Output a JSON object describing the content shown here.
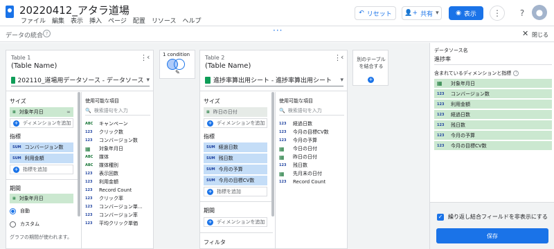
{
  "app": {
    "title": "20220412_アタラ道場",
    "menu": [
      "ファイル",
      "編集",
      "表示",
      "挿入",
      "ページ",
      "配置",
      "リソース",
      "ヘルプ"
    ]
  },
  "toolbar": {
    "reset": "リセット",
    "share": "共有",
    "view": "表示"
  },
  "subbar": {
    "title": "データの統合",
    "close": "閉じる"
  },
  "join": {
    "label": "1 condition"
  },
  "table1": {
    "name": "Table 1",
    "alias": "(Table Name)",
    "source": "202110_道場用データソース - データソース",
    "dims_label": "サイズ",
    "dims": [
      "対象年月日"
    ],
    "add_dim": "ディメンションを追加",
    "metrics_label": "指標",
    "metrics": [
      "コンバージョン数",
      "利用金額"
    ],
    "add_metric": "指標を追加",
    "period_label": "期間",
    "period_field": "対象年月日",
    "period_auto": "自動",
    "period_custom": "カスタム",
    "period_note": "グラフの期間が使われます。",
    "avail_label": "使用可能な項目",
    "search": "検索語句を入力",
    "fields": [
      {
        "t": "ABC",
        "n": "キャンペーン"
      },
      {
        "t": "123",
        "n": "クリック数"
      },
      {
        "t": "123",
        "n": "コンバージョン数"
      },
      {
        "t": "cal",
        "n": "対象年月日"
      },
      {
        "t": "ABC",
        "n": "媒体"
      },
      {
        "t": "ABC",
        "n": "媒体種別"
      },
      {
        "t": "123",
        "n": "表示回数"
      },
      {
        "t": "123",
        "n": "利用金額"
      },
      {
        "t": "123",
        "n": "Record Count"
      },
      {
        "t": "123",
        "n": "クリック率"
      },
      {
        "t": "123",
        "n": "コンバージョン単..."
      },
      {
        "t": "123",
        "n": "コンバージョン率"
      },
      {
        "t": "123",
        "n": "平均クリック単価"
      }
    ]
  },
  "table2": {
    "name": "Table 2",
    "alias": "(Table Name)",
    "source": "進捗率算出用シート - 進捗率算出用シート",
    "dims_label": "サイズ",
    "dims": [
      "昨日の日付"
    ],
    "add_dim": "ディメンションを追加",
    "metrics_label": "指標",
    "metrics": [
      "経過日数",
      "残日数",
      "今月の予算",
      "今月の目標CV数"
    ],
    "add_metric": "指標を追加",
    "period_label": "期間",
    "add_dim2": "ディメンションを追加",
    "filter_label": "フィルタ",
    "avail_label": "使用可能な項目",
    "search": "検索語句を入力",
    "fields": [
      {
        "t": "123",
        "n": "経過日数"
      },
      {
        "t": "123",
        "n": "今月の目標CV数"
      },
      {
        "t": "123",
        "n": "今月の予算"
      },
      {
        "t": "cal",
        "n": "今日の日付"
      },
      {
        "t": "cal",
        "n": "昨日の日付"
      },
      {
        "t": "123",
        "n": "残日数"
      },
      {
        "t": "cal",
        "n": "先月末の日付"
      },
      {
        "t": "123",
        "n": "Record Count"
      }
    ]
  },
  "addTable": {
    "label": "別のテーブルを結合する"
  },
  "right": {
    "ds_label": "データソース名",
    "ds_value": "進捗率",
    "included_label": "含まれているディメンションと指標",
    "items": [
      {
        "t": "cal",
        "n": "対象年月日"
      },
      {
        "t": "123",
        "n": "コンバージョン数"
      },
      {
        "t": "123",
        "n": "利用金額"
      },
      {
        "t": "123",
        "n": "経過日数"
      },
      {
        "t": "123",
        "n": "残日数"
      },
      {
        "t": "123",
        "n": "今月の予算"
      },
      {
        "t": "123",
        "n": "今月の目標CV数"
      }
    ],
    "checkbox": "繰り返し結合フィールドを非表示にする",
    "save": "保存"
  }
}
